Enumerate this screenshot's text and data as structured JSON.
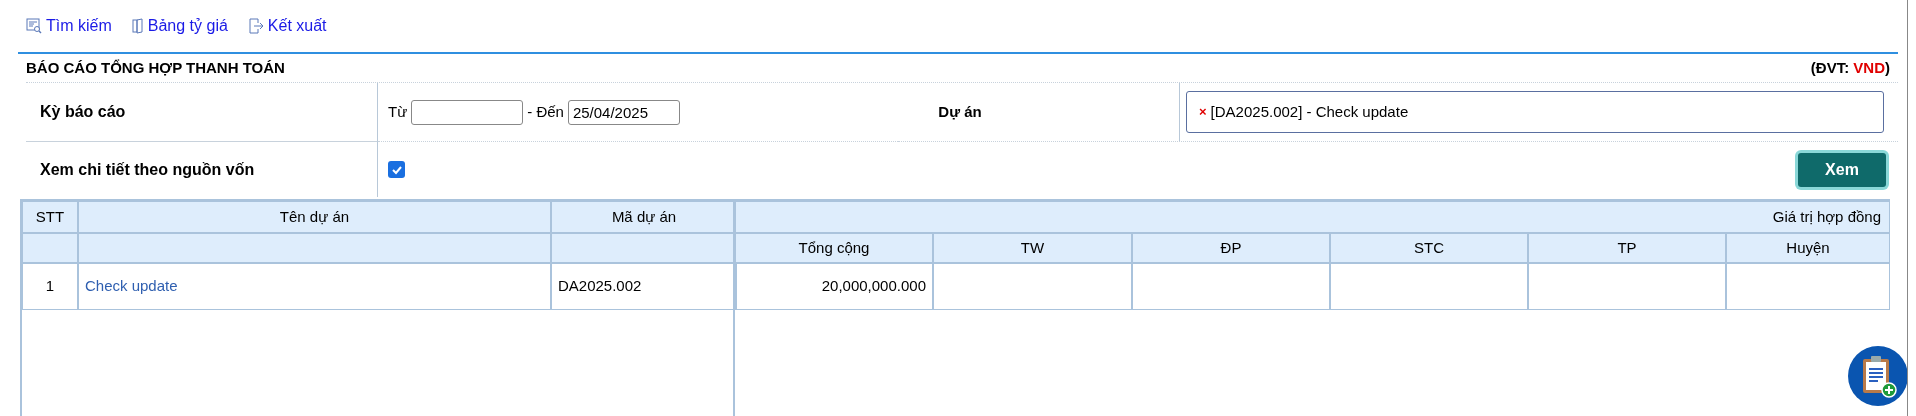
{
  "toolbar": [
    {
      "kind": "search",
      "label": "Tìm kiếm"
    },
    {
      "kind": "rates",
      "label": "Bảng tỷ giá"
    },
    {
      "kind": "export",
      "label": "Kết xuất"
    }
  ],
  "report": {
    "title": "BÁO CÁO TỔNG HỢP THANH TOÁN",
    "unit_open": "(ĐVT: ",
    "unit_value": "VND",
    "unit_close": ")"
  },
  "filters": {
    "period": {
      "label": "Kỳ báo cáo",
      "from_label": "Từ",
      "to_label": "- Đến",
      "to_value": "25/04/2025"
    },
    "project": {
      "label": "Dự án",
      "remove": "×",
      "chip": "[DA2025.002] - Check update"
    },
    "detail": {
      "label": "Xem chi tiết theo nguồn vốn",
      "checked": true
    },
    "view_button": "Xem"
  },
  "table": {
    "fixed_columns": [
      "STT",
      "Tên dự án",
      "Mã dự án"
    ],
    "group_header": "Giá trị hợp đồng",
    "value_columns": [
      "Tổng cộng",
      "TW",
      "ĐP",
      "STC",
      "TP",
      "Huyện"
    ],
    "rows": [
      {
        "stt": "1",
        "name": "Check update",
        "code": "DA2025.002",
        "total": "20,000,000.000"
      }
    ]
  }
}
